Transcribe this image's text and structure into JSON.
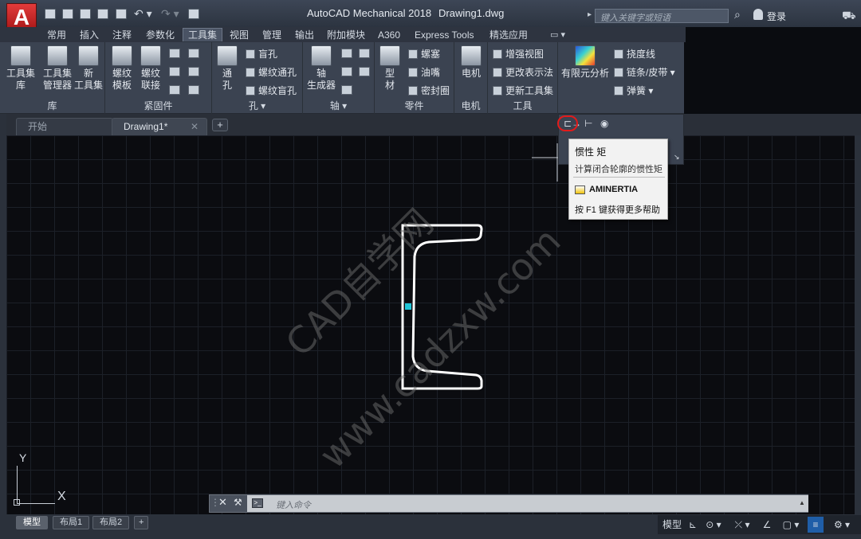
{
  "title_bar": {
    "app_logo": "A",
    "app_logo_sub": "M",
    "app_name": "AutoCAD Mechanical 2018",
    "drawing_name": "Drawing1.dwg",
    "search_placeholder": "键入关键字或短语",
    "login": "登录"
  },
  "ribbon_tabs": [
    "常用",
    "插入",
    "注释",
    "参数化",
    "工具集",
    "视图",
    "管理",
    "输出",
    "附加模块",
    "A360",
    "Express Tools",
    "精选应用"
  ],
  "active_tab": "工具集",
  "panels": {
    "library": {
      "title": "库",
      "buttons": [
        {
          "label": "工具集\n库"
        },
        {
          "label": "工具集\n管理器"
        },
        {
          "label": "新\n工具集"
        }
      ]
    },
    "fasteners": {
      "title": "紧固件",
      "buttons": [
        {
          "label": "螺纹\n模板"
        },
        {
          "label": "螺纹\n联接"
        }
      ]
    },
    "holes": {
      "title": "孔",
      "big": {
        "label": "通\n孔"
      },
      "items": [
        "盲孔",
        "螺纹通孔",
        "螺纹盲孔"
      ]
    },
    "shafts": {
      "title": "轴",
      "big": {
        "label": "轴\n生成器"
      }
    },
    "parts": {
      "title": "零件",
      "big": {
        "label": "型\n材"
      },
      "items": [
        "螺塞",
        "油嘴",
        "密封圈"
      ]
    },
    "motor": {
      "title": "电机",
      "big": {
        "label": "电机"
      }
    },
    "tools": {
      "title": "工具",
      "items": [
        "增强视图",
        "更改表示法",
        "更新工具集"
      ]
    },
    "extra": {
      "big": {
        "label": "有限元分析"
      },
      "items": [
        "挠度线",
        "链条/皮带",
        "弹簧"
      ]
    }
  },
  "doc_tabs": [
    {
      "label": "开始"
    },
    {
      "label": "Drawing1*"
    }
  ],
  "tooltip": {
    "title": "惯性 矩",
    "description": "计算闭合轮廓的惯性矩",
    "command": "AMINERTIA",
    "help": "按 F1 键获得更多帮助"
  },
  "command_line": {
    "placeholder": "键入命令"
  },
  "layout_tabs": [
    "模型",
    "布局1",
    "布局2"
  ],
  "status": {
    "model": "模型"
  },
  "ucs": {
    "x": "X",
    "y": "Y"
  },
  "watermark": [
    "CAD自学网",
    "www.cadzxw.com"
  ],
  "colors": {
    "accent": "#e21b1b",
    "grip": "#21c6d8"
  }
}
